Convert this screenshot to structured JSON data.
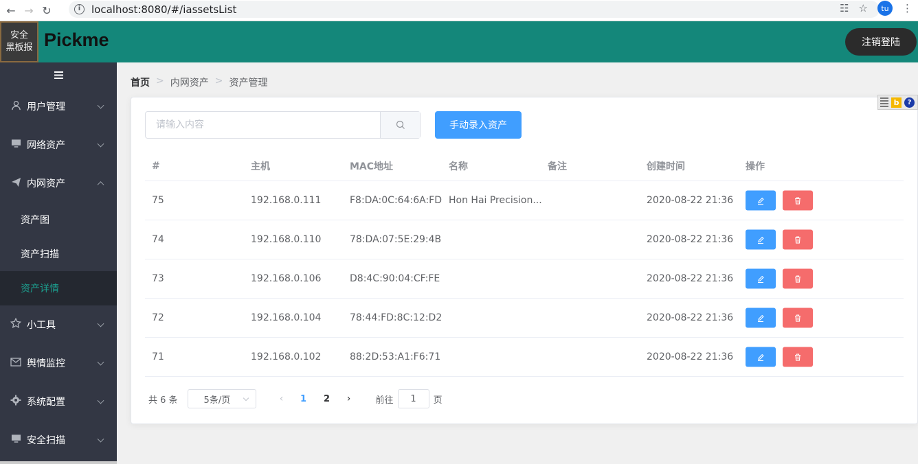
{
  "browser": {
    "url": "localhost:8080/#/iassetsList",
    "profile_initials": "tu"
  },
  "header": {
    "logo_text_line1": "安全",
    "logo_text_line2": "黑板报",
    "brand": "Pickme",
    "logout_label": "注销登陆",
    "bg_color": "#14877a"
  },
  "sidebar": {
    "items": [
      {
        "label": "用户管理",
        "icon": "user-icon"
      },
      {
        "label": "网络资产",
        "icon": "monitor-icon"
      },
      {
        "label": "内网资产",
        "icon": "paper-plane-icon",
        "expanded": true,
        "children": [
          {
            "label": "资产图"
          },
          {
            "label": "资产扫描"
          },
          {
            "label": "资产详情",
            "active": true
          }
        ]
      },
      {
        "label": "小工具",
        "icon": "star-icon"
      },
      {
        "label": "舆情监控",
        "icon": "mail-icon"
      },
      {
        "label": "系统配置",
        "icon": "gear-icon"
      },
      {
        "label": "安全扫描",
        "icon": "monitor-icon"
      }
    ]
  },
  "breadcrumb": [
    "首页",
    "内网资产",
    "资产管理"
  ],
  "search": {
    "placeholder": "请输入内容",
    "value": ""
  },
  "add_button_label": "手动录入资产",
  "table": {
    "columns": [
      "#",
      "主机",
      "MAC地址",
      "名称",
      "备注",
      "创建时间",
      "操作"
    ],
    "rows": [
      {
        "id": "75",
        "host": "192.168.0.111",
        "mac": "F8:DA:0C:64:6A:FD",
        "name": "Hon Hai Precision...",
        "note": "",
        "created": "2020-08-22 21:36"
      },
      {
        "id": "74",
        "host": "192.168.0.110",
        "mac": "78:DA:07:5E:29:4B",
        "name": "",
        "note": "",
        "created": "2020-08-22 21:36"
      },
      {
        "id": "73",
        "host": "192.168.0.106",
        "mac": "D8:4C:90:04:CF:FE",
        "name": "",
        "note": "",
        "created": "2020-08-22 21:36"
      },
      {
        "id": "72",
        "host": "192.168.0.104",
        "mac": "78:44:FD:8C:12:D2",
        "name": "",
        "note": "",
        "created": "2020-08-22 21:36"
      },
      {
        "id": "71",
        "host": "192.168.0.102",
        "mac": "88:2D:53:A1:F6:71",
        "name": "",
        "note": "",
        "created": "2020-08-22 21:36"
      }
    ]
  },
  "pagination": {
    "total_text": "共 6 条",
    "page_size": "5条/页",
    "pages": [
      "1",
      "2"
    ],
    "current_page": "1",
    "goto_prefix": "前往",
    "goto_value": "1",
    "goto_suffix": "页"
  },
  "colors": {
    "primary": "#409eff",
    "danger": "#f56c6c",
    "sidebar_bg": "#333744",
    "active_text": "#1c9e8e"
  }
}
